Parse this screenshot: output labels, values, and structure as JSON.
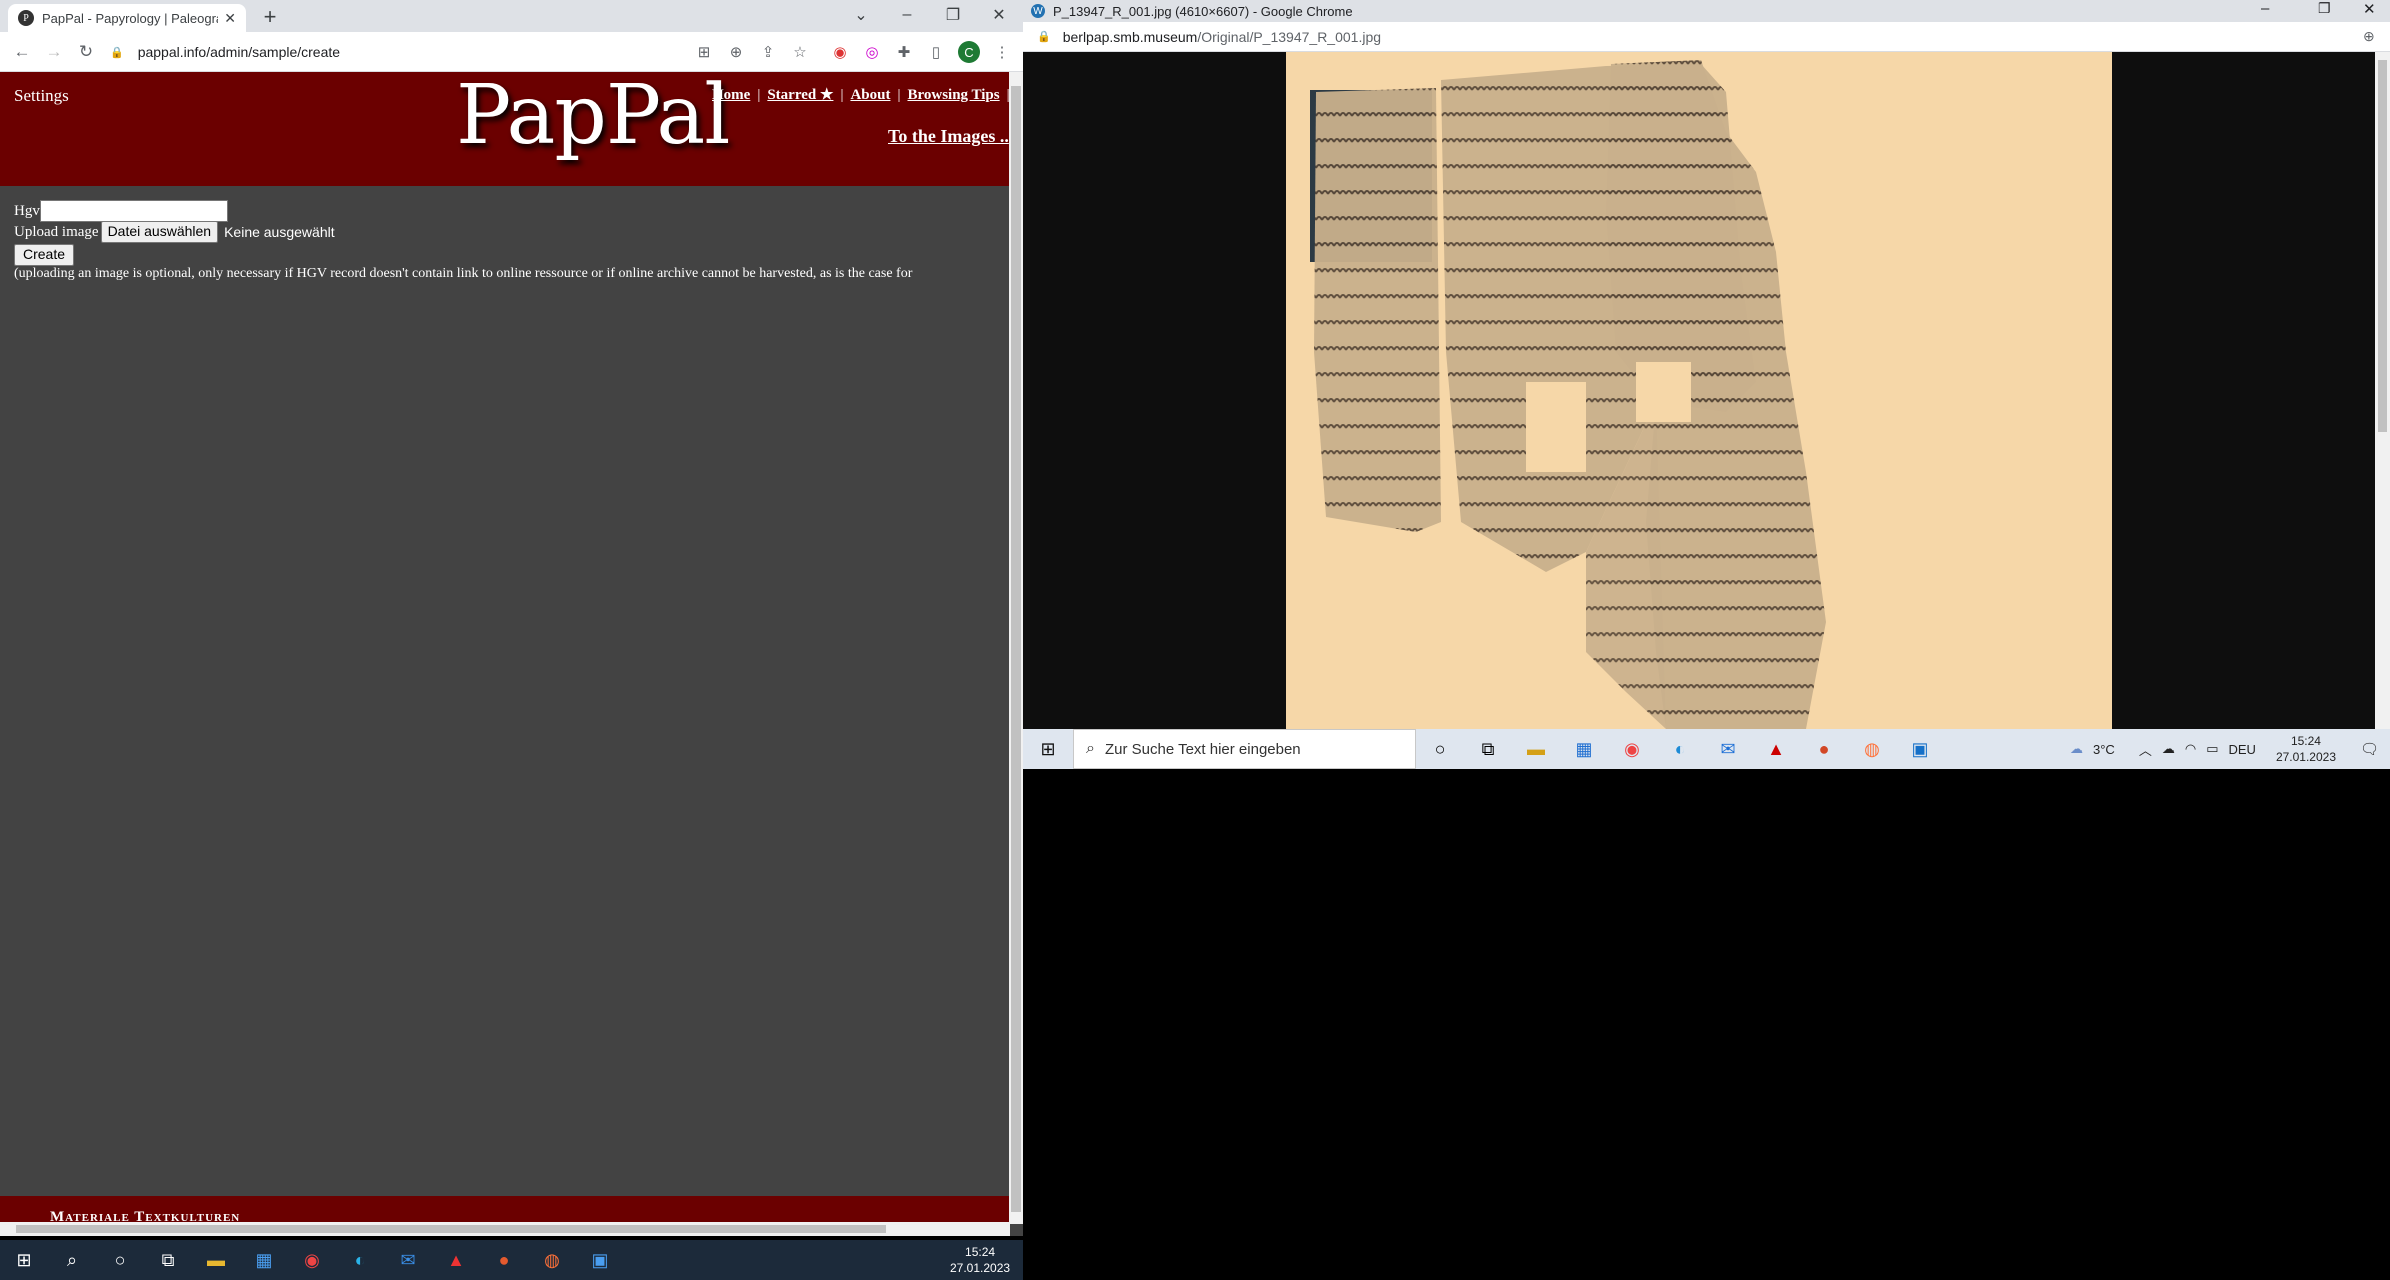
{
  "left_window": {
    "tab_title": "PapPal - Papyrology | Paleograph",
    "url": "pappal.info/admin/sample/create",
    "profile_initial": "C"
  },
  "page": {
    "settings": "Settings",
    "logo": "PapPal",
    "nav": [
      "Home",
      "Starred ★",
      "About",
      "Browsing Tips"
    ],
    "to_images": "To the Images ..",
    "hgv_label": "Hgv",
    "hgv_value": "",
    "upload_label": "Upload image",
    "file_button": "Datei auswählen",
    "file_status": "Keine ausgewählt",
    "create_button": "Create",
    "note": "(uploading an image is optional, only necessary if HGV record doesn't contain link to online ressource or if online archive cannot be harvested, as is the case for",
    "footer": "Materiale Textkulturen"
  },
  "right_window": {
    "title": "P_13947_R_001.jpg (4610×6607) - Google Chrome",
    "url_host": "berlpap.smb.museum",
    "url_path": "/Original/P_13947_R_001.jpg",
    "search_placeholder": "Zur Suche Text hier eingeben",
    "weather": "3°C",
    "lang": "DEU",
    "time": "15:24",
    "date": "27.01.2023"
  },
  "bottom_taskbar": {
    "time": "15:24",
    "date": "27.01.2023"
  },
  "colors": {
    "header": "#6b0000",
    "page_bg": "#434343",
    "papyrus_paper": "#f6d7a8"
  }
}
